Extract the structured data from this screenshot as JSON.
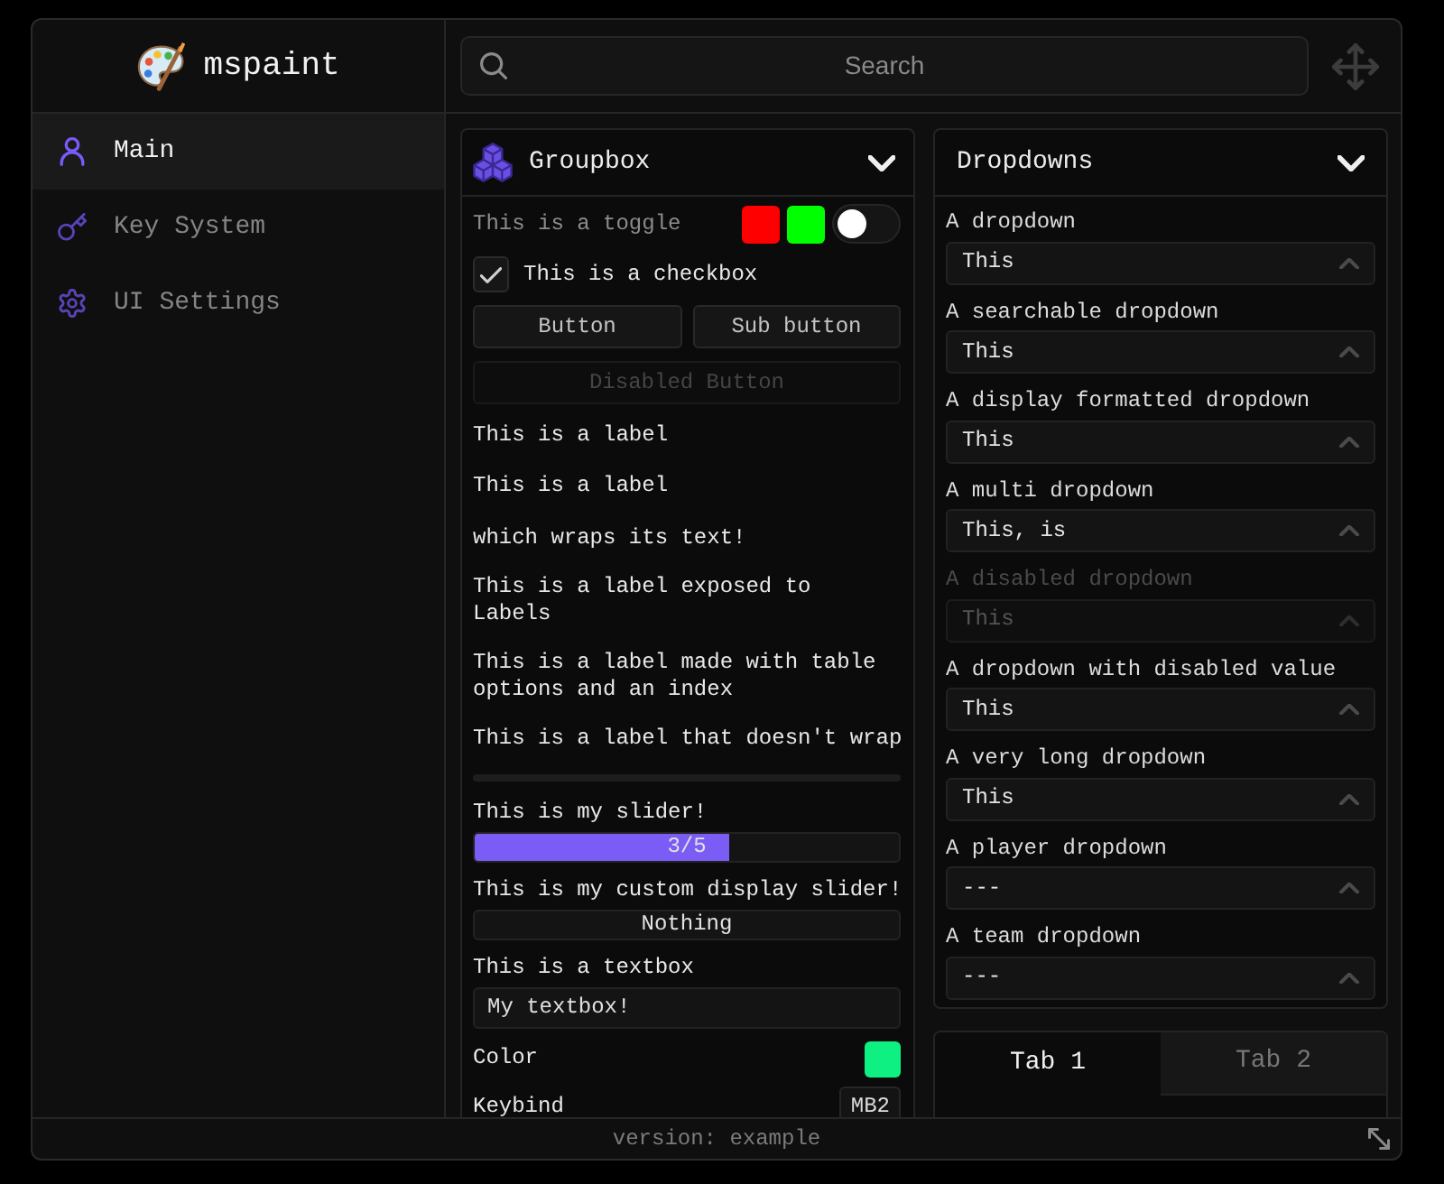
{
  "window": {
    "title": "mspaint"
  },
  "search": {
    "placeholder": "Search"
  },
  "sidebar": {
    "items": [
      {
        "label": "Main",
        "selected": true
      },
      {
        "label": "Key System",
        "selected": false
      },
      {
        "label": "UI Settings",
        "selected": false
      }
    ]
  },
  "groupbox": {
    "title": "Groupbox",
    "elements": [
      {
        "kind": "toggle",
        "label": "This is a toggle",
        "on": false,
        "color_pickers": [
          {
            "color": "#ff0000"
          },
          {
            "color": "#00ff00"
          }
        ]
      },
      {
        "kind": "checkbox",
        "label": "This is a checkbox",
        "checked": true
      },
      {
        "kind": "buttons",
        "buttons": [
          {
            "label": "Button",
            "disabled": false
          },
          {
            "label": "Sub button",
            "disabled": false
          }
        ]
      },
      {
        "kind": "buttons",
        "buttons": [
          {
            "label": "Disabled Button",
            "disabled": true
          }
        ]
      },
      {
        "kind": "label",
        "text": "This is a label"
      },
      {
        "kind": "label",
        "text": "This is a label\n\nwhich wraps its text!"
      },
      {
        "kind": "label",
        "text": "This is a label exposed to Labels",
        "wrap": true
      },
      {
        "kind": "label",
        "text": "This is a label made with table options and an index",
        "wrap": true
      },
      {
        "kind": "label",
        "text": "This is a label that doesn't wrap",
        "wrap": false
      },
      {
        "kind": "divider"
      },
      {
        "kind": "slider",
        "label": "This is my slider!",
        "level": 0.6,
        "reading": "3/5"
      },
      {
        "kind": "slider",
        "label": "This is my custom display slider!",
        "level": 0,
        "reading": "Nothing"
      },
      {
        "kind": "textbox",
        "label": "This is a textbox",
        "value": "My textbox!"
      },
      {
        "kind": "color",
        "label": "Color",
        "color": "#0ff082"
      },
      {
        "kind": "keybind",
        "label": "Keybind",
        "key": "MB2"
      }
    ]
  },
  "dropdowns": {
    "title": "Dropdowns",
    "items": [
      {
        "label": "A dropdown",
        "value": "This",
        "disabled": false
      },
      {
        "label": "A searchable dropdown",
        "value": "This",
        "disabled": false
      },
      {
        "label": "A display formatted dropdown",
        "value": "This",
        "disabled": false
      },
      {
        "label": "A multi dropdown",
        "value": "This, is",
        "disabled": false
      },
      {
        "label": "A disabled dropdown",
        "value": "This",
        "disabled": true
      },
      {
        "label": "A dropdown with disabled value",
        "value": "This",
        "disabled": false
      },
      {
        "label": "A very long dropdown",
        "value": "This",
        "disabled": false
      },
      {
        "label": "A player dropdown",
        "value": "---",
        "disabled": false
      },
      {
        "label": "A team dropdown",
        "value": "---",
        "disabled": false
      }
    ]
  },
  "tabbox": {
    "tabs": [
      {
        "label": "Tab 1",
        "selected": true
      },
      {
        "label": "Tab 2",
        "selected": false
      }
    ]
  },
  "status_bar": {
    "text": "version: example"
  }
}
